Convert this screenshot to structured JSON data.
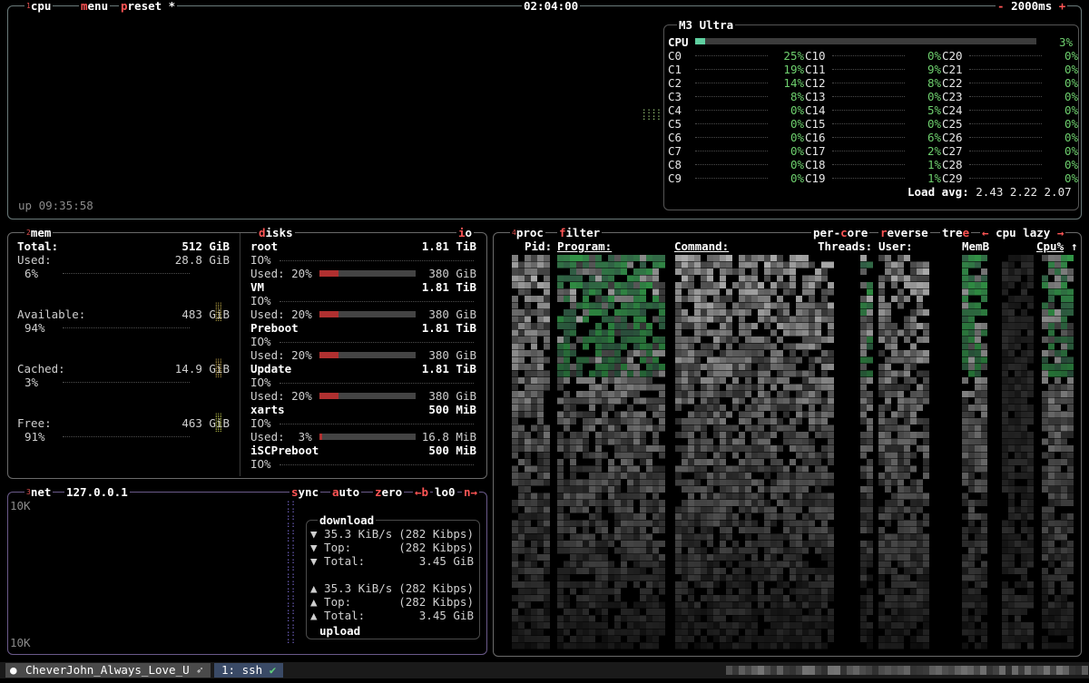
{
  "cpu": {
    "tag": "1",
    "title": "cpu",
    "menu_label": "menu",
    "preset_label": "preset *",
    "clock": "02:04:00",
    "interval_minus": "-",
    "interval": "2000ms",
    "interval_plus": "+",
    "uptime": "up 09:35:58",
    "model": "M3 Ultra",
    "total_label": "CPU",
    "total_pct": "3%",
    "total_fraction": 0.03,
    "cores": [
      {
        "name": "C0",
        "pct": "25%"
      },
      {
        "name": "C1",
        "pct": "19%"
      },
      {
        "name": "C2",
        "pct": "14%"
      },
      {
        "name": "C3",
        "pct": "8%"
      },
      {
        "name": "C4",
        "pct": "0%"
      },
      {
        "name": "C5",
        "pct": "0%"
      },
      {
        "name": "C6",
        "pct": "0%"
      },
      {
        "name": "C7",
        "pct": "0%"
      },
      {
        "name": "C8",
        "pct": "0%"
      },
      {
        "name": "C9",
        "pct": "0%"
      },
      {
        "name": "C10",
        "pct": "0%"
      },
      {
        "name": "C11",
        "pct": "9%"
      },
      {
        "name": "C12",
        "pct": "8%"
      },
      {
        "name": "C13",
        "pct": "0%"
      },
      {
        "name": "C14",
        "pct": "5%"
      },
      {
        "name": "C15",
        "pct": "0%"
      },
      {
        "name": "C16",
        "pct": "6%"
      },
      {
        "name": "C17",
        "pct": "2%"
      },
      {
        "name": "C18",
        "pct": "1%"
      },
      {
        "name": "C19",
        "pct": "1%"
      },
      {
        "name": "C20",
        "pct": "0%"
      },
      {
        "name": "C21",
        "pct": "0%"
      },
      {
        "name": "C22",
        "pct": "0%"
      },
      {
        "name": "C23",
        "pct": "0%"
      },
      {
        "name": "C24",
        "pct": "0%"
      },
      {
        "name": "C25",
        "pct": "0%"
      },
      {
        "name": "C26",
        "pct": "0%"
      },
      {
        "name": "C27",
        "pct": "0%"
      },
      {
        "name": "C28",
        "pct": "0%"
      },
      {
        "name": "C29",
        "pct": "0%"
      }
    ],
    "load_label": "Load avg:",
    "load_values": "2.43 2.22 2.07"
  },
  "mem": {
    "tag": "2",
    "title": "mem",
    "rows": [
      {
        "label": "Total:",
        "value": "512 GiB",
        "pct": ""
      },
      {
        "label": "Used:",
        "value": "28.8 GiB",
        "pct": "6%"
      },
      {
        "label": "Available:",
        "value": "483 GiB",
        "pct": "94%"
      },
      {
        "label": "Cached:",
        "value": "14.9 GiB",
        "pct": "3%"
      },
      {
        "label": "Free:",
        "value": "463 GiB",
        "pct": "91%"
      }
    ]
  },
  "disks": {
    "title": "disks",
    "io_label": "io",
    "io_row_label": "IO%",
    "used_label": "Used:",
    "items": [
      {
        "name": "root",
        "size": "1.81 TiB",
        "used_pct": "20%",
        "used_fraction": 0.2,
        "free": "380 GiB"
      },
      {
        "name": "VM",
        "size": "1.81 TiB",
        "used_pct": "20%",
        "used_fraction": 0.2,
        "free": "380 GiB"
      },
      {
        "name": "Preboot",
        "size": "1.81 TiB",
        "used_pct": "20%",
        "used_fraction": 0.2,
        "free": "380 GiB"
      },
      {
        "name": "Update",
        "size": "1.81 TiB",
        "used_pct": "20%",
        "used_fraction": 0.2,
        "free": "380 GiB"
      },
      {
        "name": "xarts",
        "size": "500 MiB",
        "used_pct": "3%",
        "used_fraction": 0.03,
        "free": "16.8 MiB"
      },
      {
        "name": "iSCPreboot",
        "size": "500 MiB",
        "used_pct": "",
        "used_fraction": 0,
        "free": ""
      }
    ]
  },
  "net": {
    "tag": "3",
    "title": "net",
    "address": "127.0.0.1",
    "sync_label": "sync",
    "auto_label": "auto",
    "zero_label": "zero",
    "prev_label": "←b",
    "iface": "lo0",
    "next_label": "n→",
    "scale_top": "10K",
    "scale_bottom": "10K",
    "download_title": "download",
    "upload_title": "upload",
    "download": [
      {
        "arrow": "▼",
        "label": "35.3 KiB/s",
        "value": "(282 Kibps)"
      },
      {
        "arrow": "▼",
        "label": "Top:",
        "value": "(282 Kibps)"
      },
      {
        "arrow": "▼",
        "label": "Total:",
        "value": "3.45 GiB"
      }
    ],
    "upload": [
      {
        "arrow": "▲",
        "label": "35.3 KiB/s",
        "value": "(282 Kibps)"
      },
      {
        "arrow": "▲",
        "label": "Top:",
        "value": "(282 Kibps)"
      },
      {
        "arrow": "▲",
        "label": "Total:",
        "value": "3.45 GiB"
      }
    ]
  },
  "proc": {
    "tag": "4",
    "title": "proc",
    "filter_label": "filter",
    "percore_label": "per-core",
    "reverse_label": "reverse",
    "tree_label": "tree",
    "sort_prev": "←",
    "sort_field": "cpu lazy",
    "sort_next": "→",
    "columns": {
      "pid": "Pid:",
      "program": "Program:",
      "command": "Command:",
      "threads": "Threads:",
      "user": "User:",
      "memb": "MemB",
      "cpu": "Cpu%"
    },
    "sort_arrow": "↑"
  },
  "statusbar": {
    "apple_icon": "apple-icon",
    "session": "CheverJohn_Always_Love_U",
    "rocket_icon": "rocket-icon",
    "window": "1: ssh",
    "check_icon": "check-icon"
  }
}
